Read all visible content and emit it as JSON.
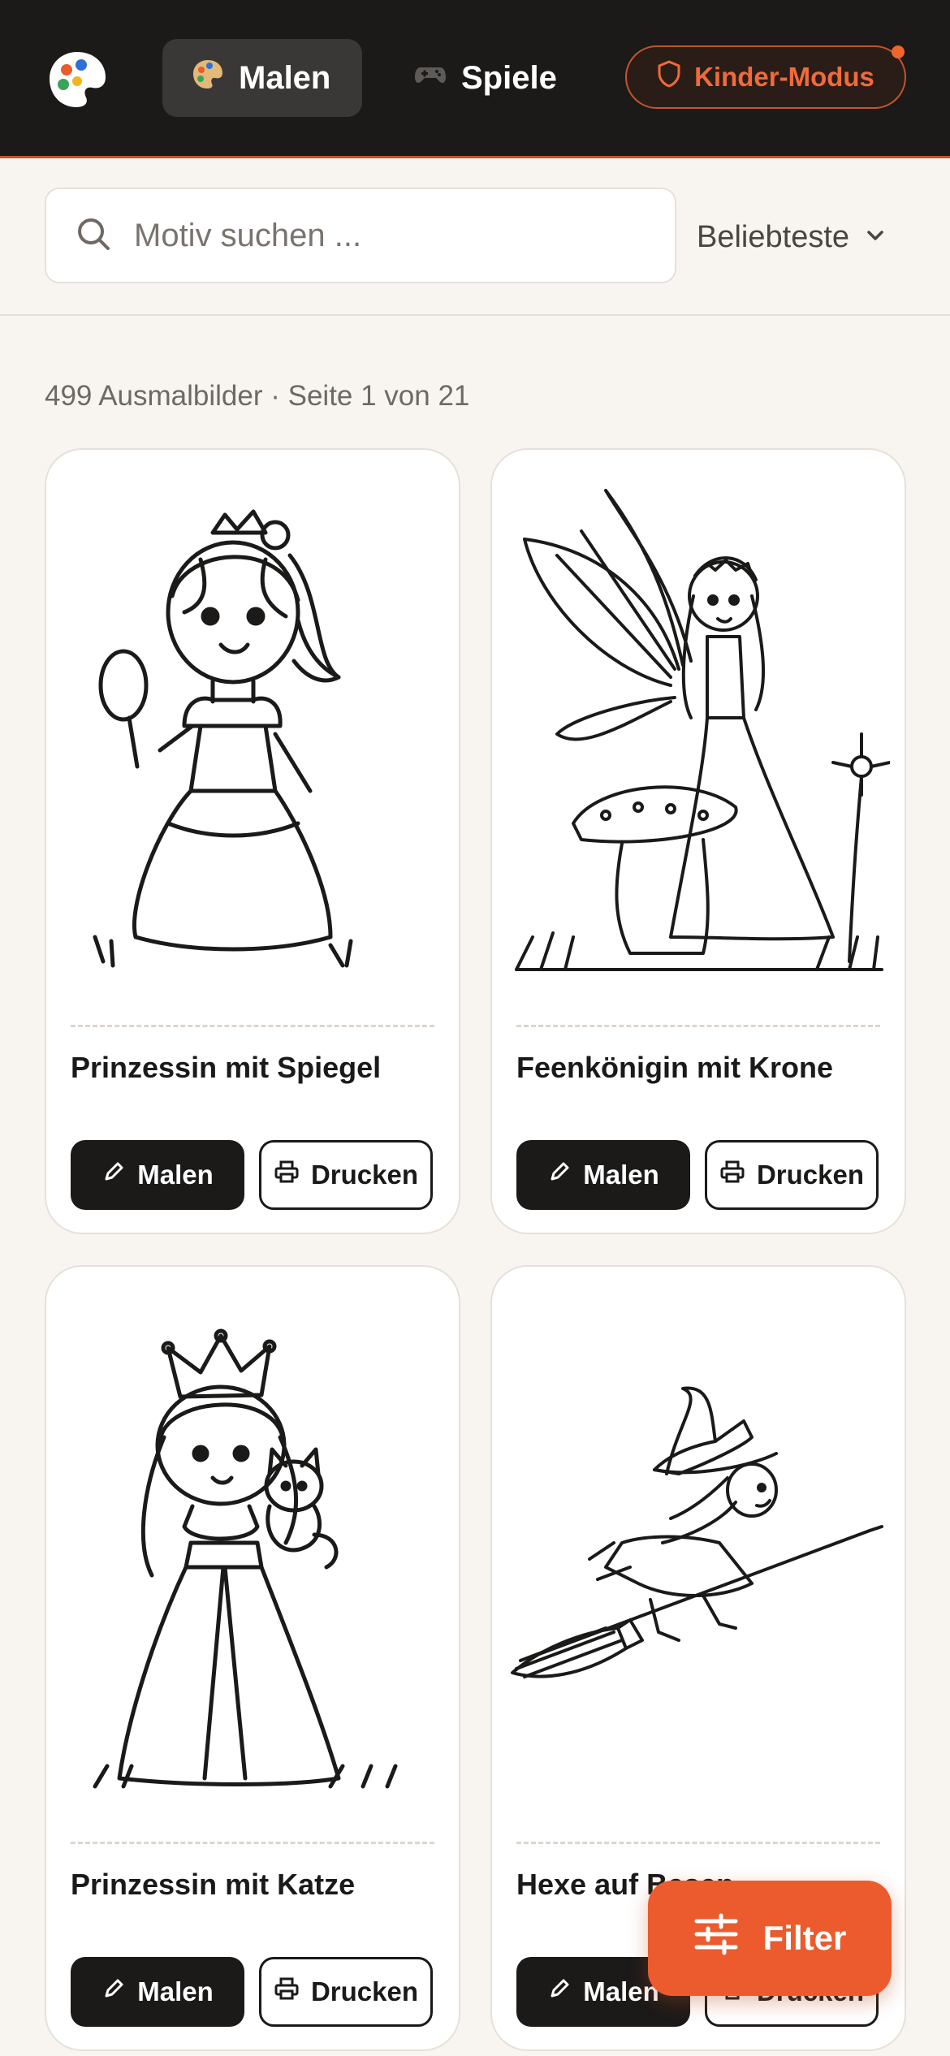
{
  "header": {
    "tabs": [
      {
        "label": "Malen",
        "icon": "palette-icon",
        "active": true
      },
      {
        "label": "Spiele",
        "icon": "gamepad-icon",
        "active": false
      }
    ],
    "kids_mode_label": "Kinder-Modus"
  },
  "search": {
    "placeholder": "Motiv suchen ..."
  },
  "sort": {
    "label": "Beliebteste"
  },
  "results": {
    "summary": "499 Ausmalbilder · Seite 1 von 21"
  },
  "cards": [
    {
      "title": "Prinzessin mit Spiegel",
      "paint_label": "Malen",
      "print_label": "Drucken"
    },
    {
      "title": "Feenkönigin mit Krone",
      "paint_label": "Malen",
      "print_label": "Drucken"
    },
    {
      "title": "Prinzessin mit Katze",
      "paint_label": "Malen",
      "print_label": "Drucken"
    },
    {
      "title": "Hexe auf Besen",
      "paint_label": "Malen",
      "print_label": "Drucken"
    }
  ],
  "filter": {
    "label": "Filter"
  },
  "colors": {
    "accent": "#ec5b2e",
    "header_bg": "#1b1a19",
    "page_bg": "#f8f5f1"
  }
}
